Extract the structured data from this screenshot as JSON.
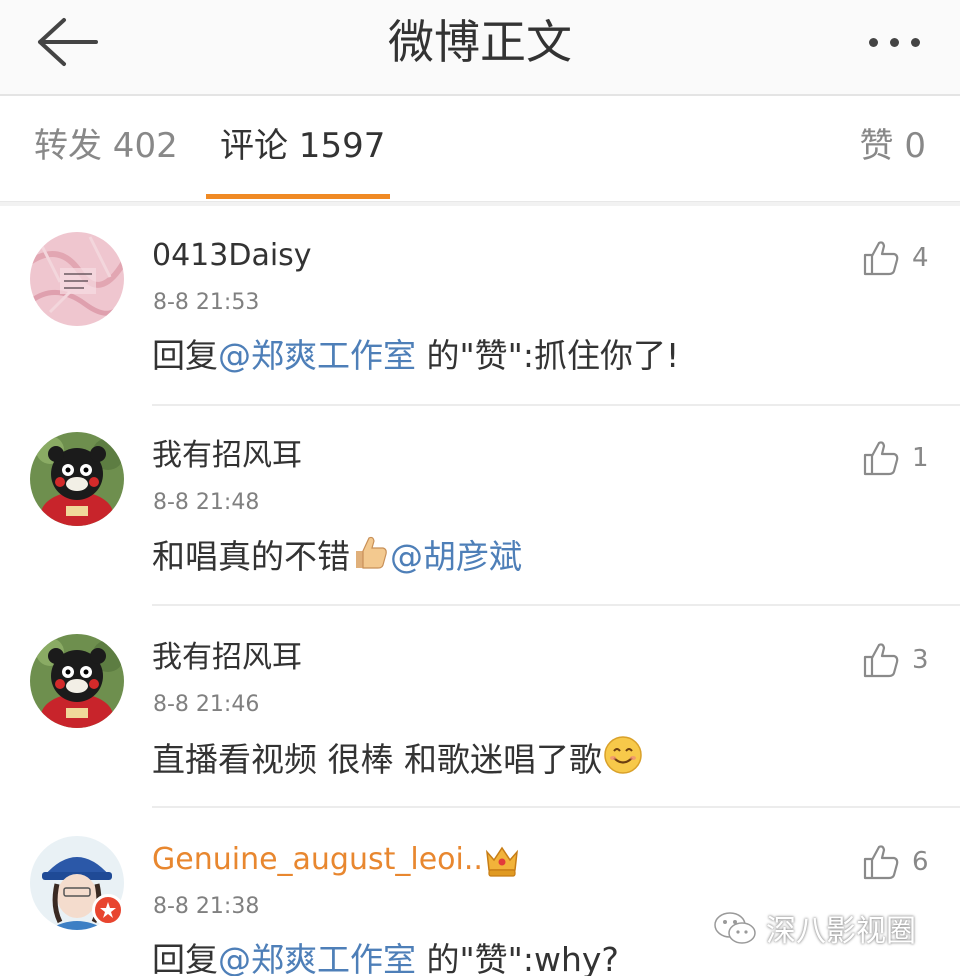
{
  "header": {
    "title": "微博正文"
  },
  "tabs": {
    "repost": "转发 402",
    "comment": "评论 1597",
    "like": "赞 0"
  },
  "colors": {
    "accent": "#f08a24",
    "mention": "#4e7fb8",
    "vip_name": "#e8872f"
  },
  "comments": [
    {
      "username": "0413Daisy",
      "time": "8-8 21:53",
      "text_pre": "回复",
      "mention": "@郑爽工作室",
      "text_post": " 的\"赞\":抓住你了!",
      "likes": "4"
    },
    {
      "username": "我有招风耳",
      "time": "8-8 21:48",
      "text_pre": "和唱真的不错",
      "emoji": "thumbs-up-emoji",
      "mention": "@胡彦斌",
      "likes": "1"
    },
    {
      "username": "我有招风耳",
      "time": "8-8 21:46",
      "text_pre": "直播看视频 很棒 和歌迷唱了歌",
      "emoji": "smile-emoji",
      "likes": "3"
    },
    {
      "username": "Genuine_august_leoi..",
      "badge": "crown-icon",
      "time": "8-8 21:38",
      "text_pre": "回复",
      "mention": "@郑爽工作室",
      "text_post": " 的\"赞\":why?",
      "likes": "6"
    }
  ],
  "watermark": {
    "text": "深八影视圈"
  }
}
